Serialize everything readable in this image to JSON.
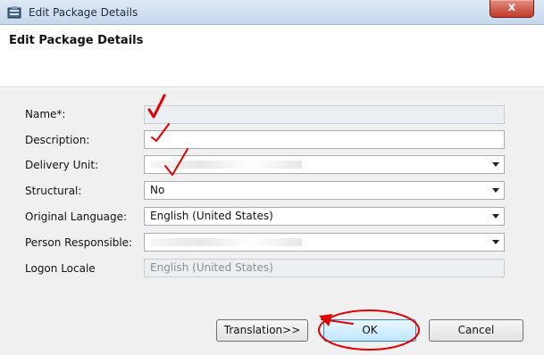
{
  "window": {
    "title": "Edit Package Details",
    "close_glyph": "x",
    "icon": "package-icon"
  },
  "dialog": {
    "heading": "Edit Package Details"
  },
  "form": {
    "fields": [
      {
        "label": "Name*:",
        "value": "",
        "type": "text"
      },
      {
        "label": "Description:",
        "value": "",
        "type": "text"
      },
      {
        "label": "Delivery Unit:",
        "value": "",
        "type": "select"
      },
      {
        "label": "Structural:",
        "value": "No",
        "type": "select"
      },
      {
        "label": "Original Language:",
        "value": "English (United States)",
        "type": "select"
      },
      {
        "label": "Person Responsible:",
        "value": "",
        "type": "select"
      },
      {
        "label": "Logon Locale",
        "value": "English (United States)",
        "type": "readonly"
      }
    ]
  },
  "buttons": {
    "translation": "Translation>>",
    "ok": "OK",
    "cancel": "Cancel"
  },
  "colors": {
    "annotation": "#e00000",
    "close_button": "#c23a2a",
    "default_button_border": "#3c7fb1"
  }
}
